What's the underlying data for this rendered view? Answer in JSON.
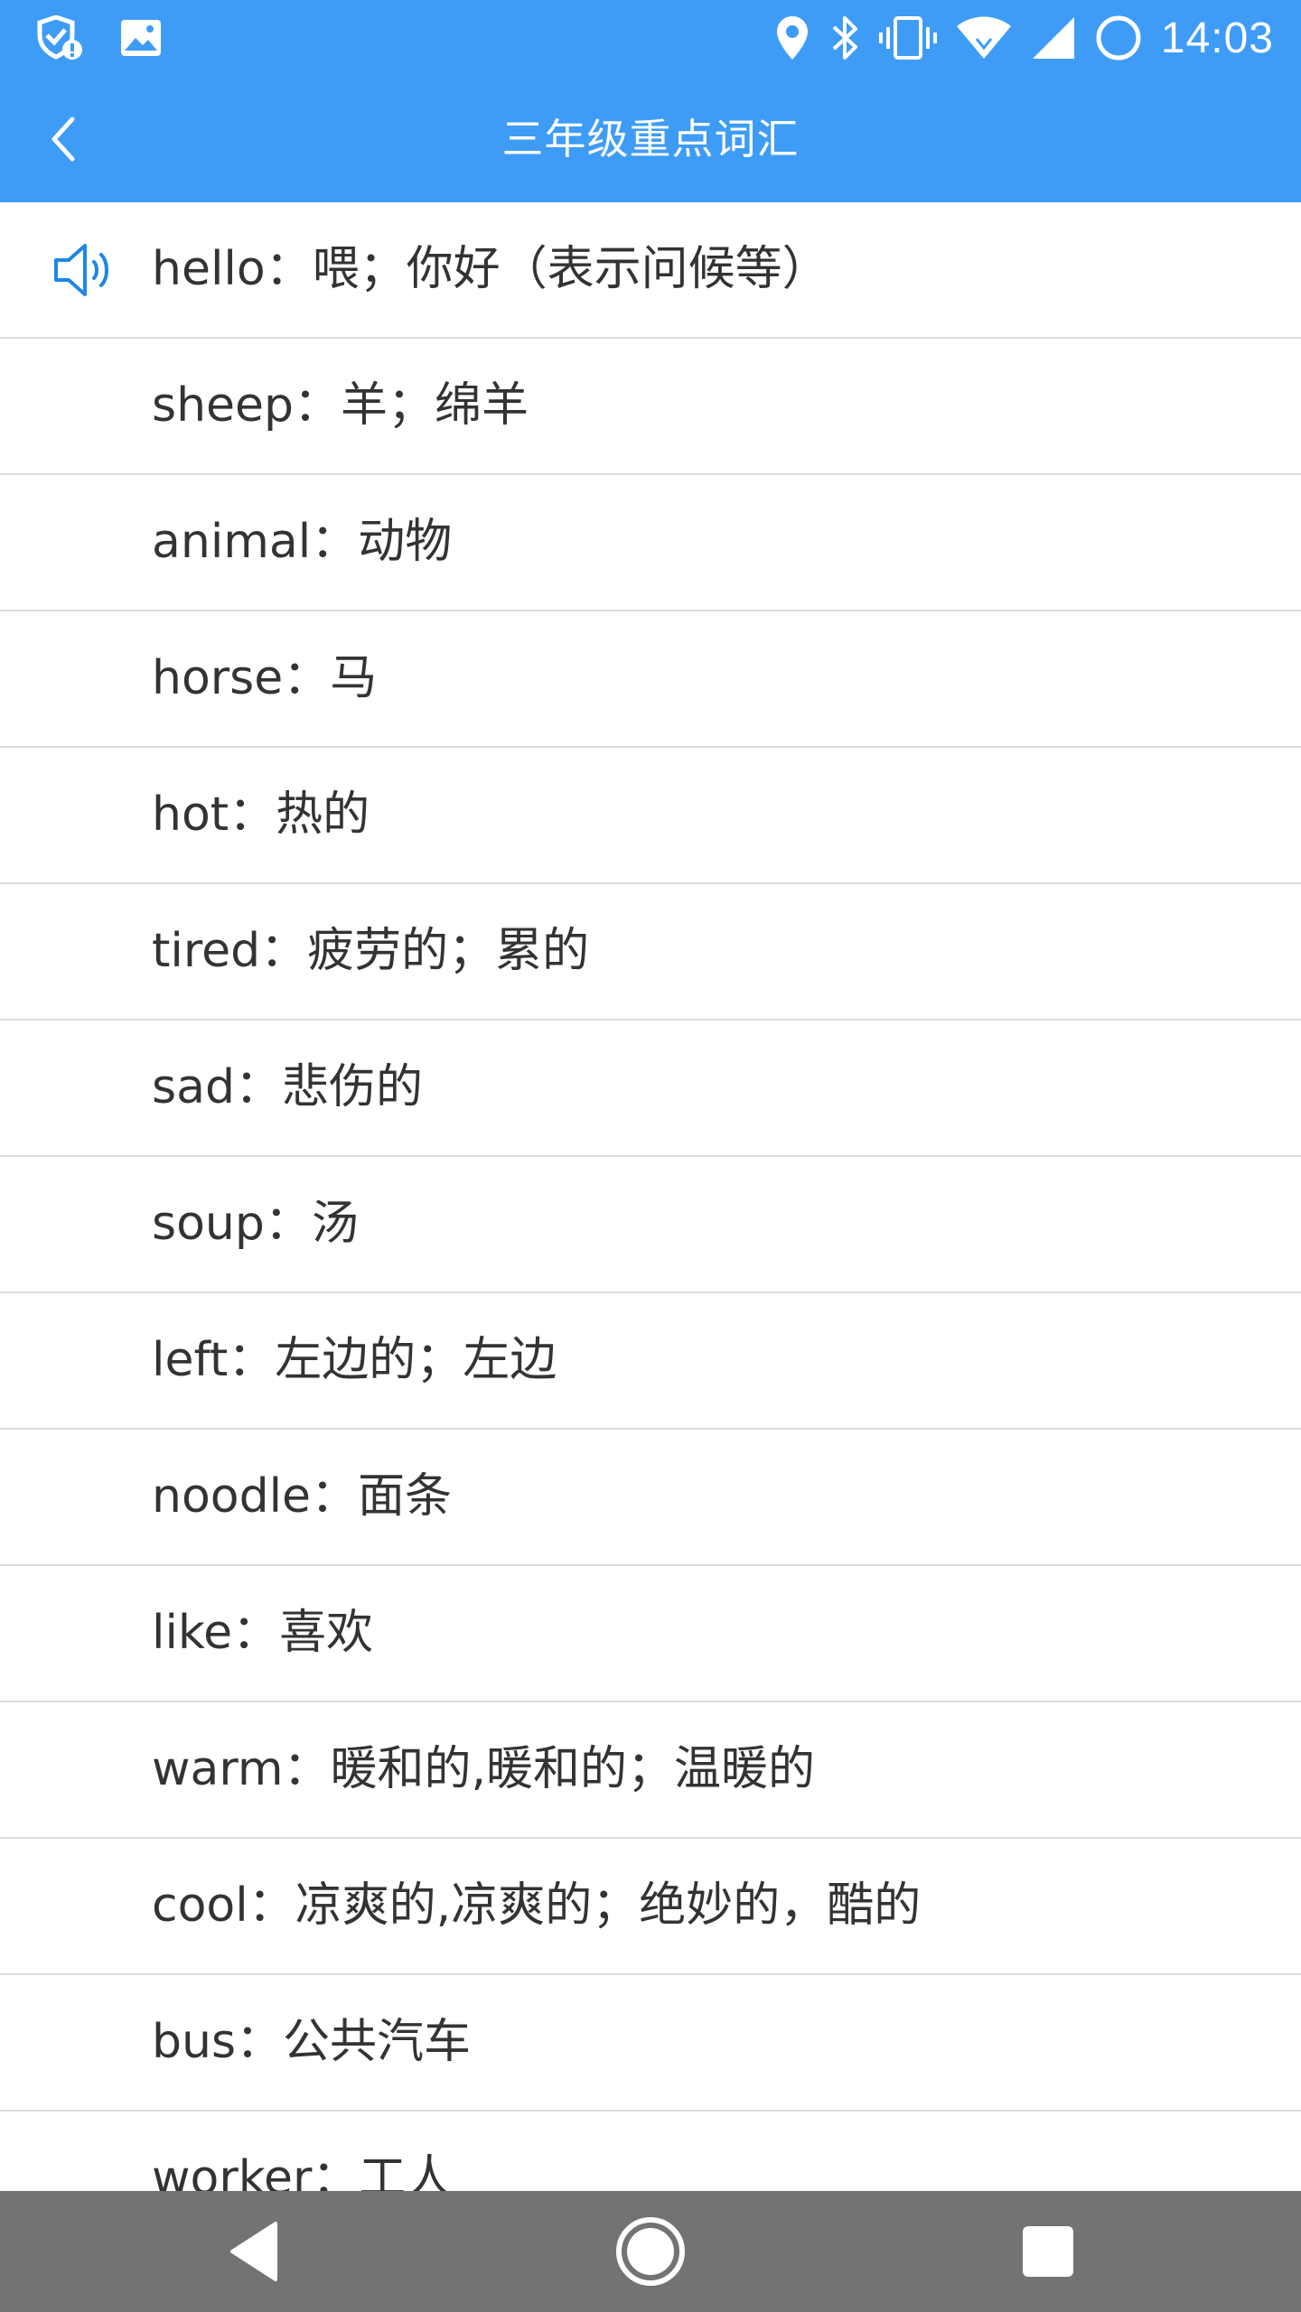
{
  "status_bar": {
    "time": "14:03",
    "icons": [
      "notification-shield-icon",
      "image-icon",
      "location-icon",
      "bluetooth-icon",
      "vibrate-icon",
      "wifi-icon",
      "signal-icon",
      "battery-circle-icon"
    ],
    "background": "#3e9cf6"
  },
  "app_bar": {
    "title": "三年级重点词汇",
    "back_icon": "chevron-left-icon",
    "background": "#3e9cf6"
  },
  "words": [
    {
      "text": "hello：喂；你好（表示问候等）",
      "playing": true
    },
    {
      "text": "sheep：羊；绵羊",
      "playing": false
    },
    {
      "text": "animal：动物",
      "playing": false
    },
    {
      "text": "horse：马",
      "playing": false
    },
    {
      "text": "hot：热的",
      "playing": false
    },
    {
      "text": "tired：疲劳的；累的",
      "playing": false
    },
    {
      "text": "sad：悲伤的",
      "playing": false
    },
    {
      "text": "soup：汤",
      "playing": false
    },
    {
      "text": "left：左边的；左边",
      "playing": false
    },
    {
      "text": "noodle：面条",
      "playing": false
    },
    {
      "text": "like：喜欢",
      "playing": false
    },
    {
      "text": "warm：暖和的,暖和的；温暖的",
      "playing": false
    },
    {
      "text": "cool：凉爽的,凉爽的；绝妙的，酷的",
      "playing": false
    },
    {
      "text": "bus：公共汽车",
      "playing": false
    },
    {
      "text": "worker：工人",
      "playing": false
    }
  ],
  "speaker_icon": "speaker-icon",
  "speaker_color": "#1e88e5",
  "nav_bar": {
    "buttons": [
      "back-triangle-icon",
      "home-circle-icon",
      "recents-square-icon"
    ],
    "background": "#737373"
  }
}
